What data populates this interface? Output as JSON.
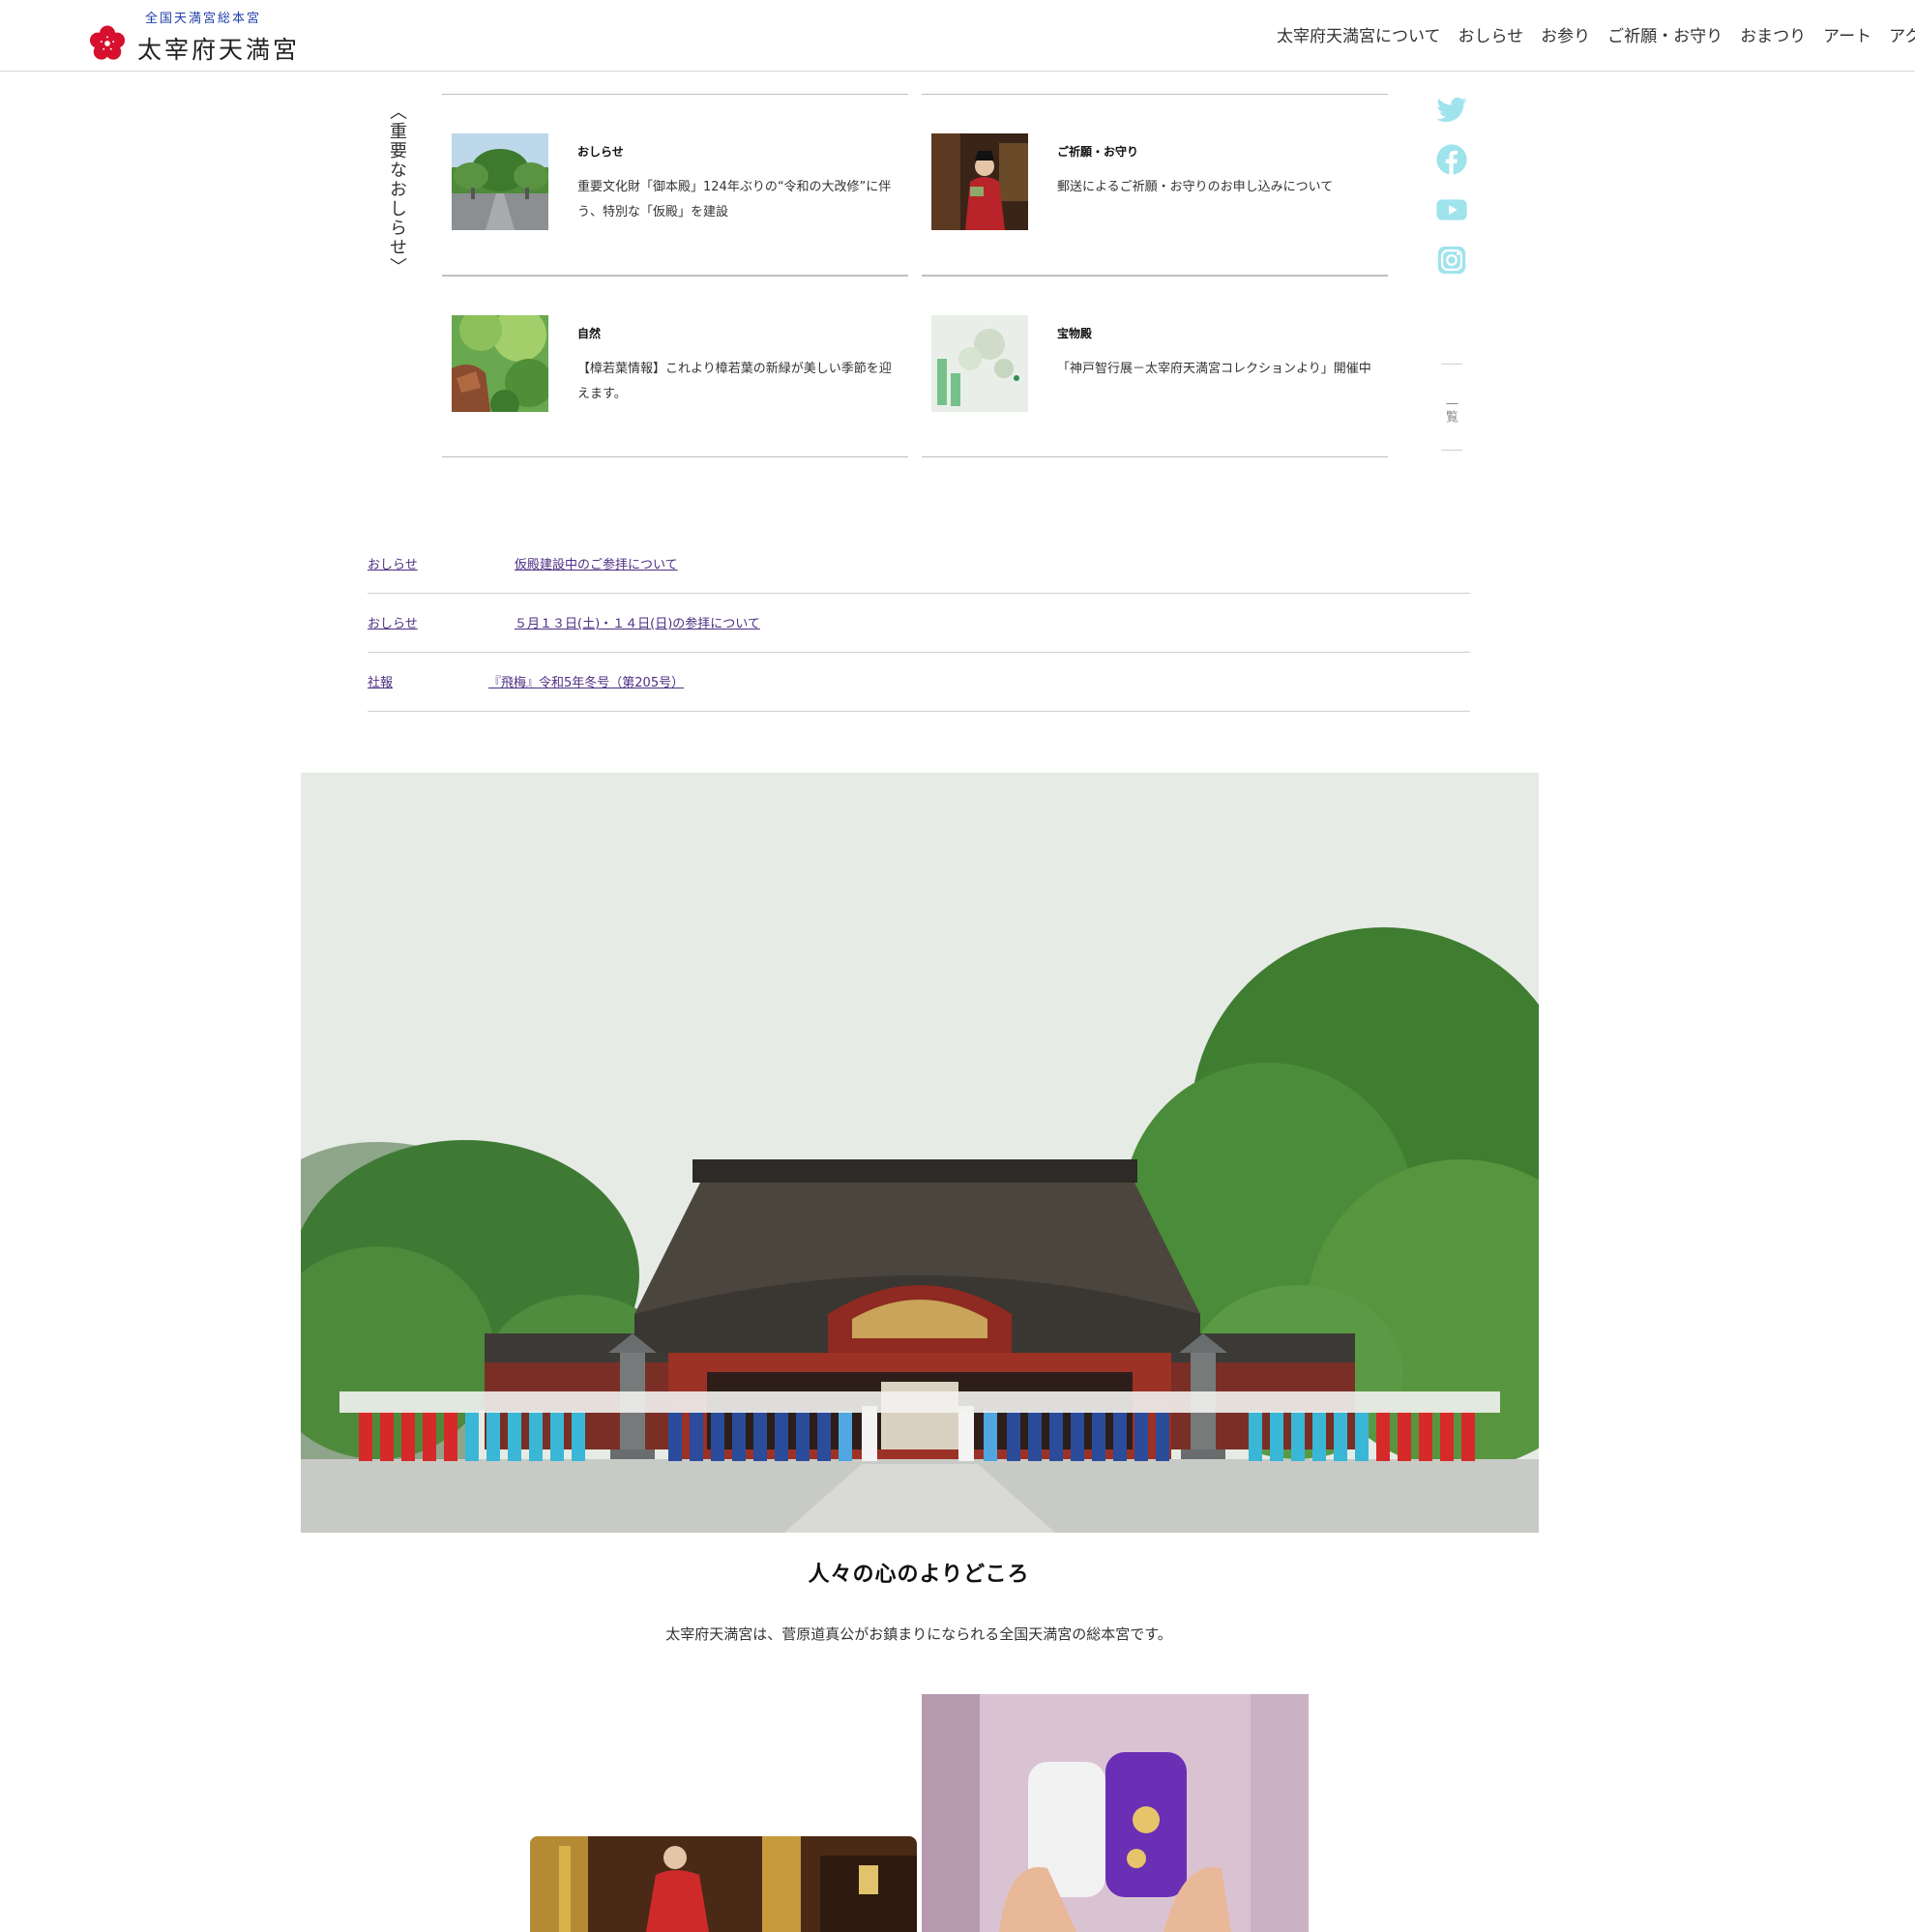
{
  "header": {
    "logo_sub": "全国天満宮総本宮",
    "logo_main": "太宰府天満宮",
    "brand_color": "#d7102e",
    "nav": [
      "太宰府天満宮について",
      "おしらせ",
      "お参り",
      "ご祈願・お守り",
      "おまつり",
      "アート",
      "アクセス"
    ]
  },
  "important": {
    "title": "〈重要なおしらせ〉",
    "cards": [
      {
        "category": "おしらせ",
        "text": "重要文化財「御本殿」124年ぶりの“令和の大改修”に伴う、特別な「仮殿」を建設"
      },
      {
        "category": "ご祈願・お守り",
        "text": "郵送によるご祈願・お守りのお申し込みについて"
      },
      {
        "category": "自然",
        "text": "【樟若葉情報】これより樟若葉の新緑が美しい季節を迎えます。"
      },
      {
        "category": "宝物殿",
        "text": "「神戸智行展－太宰府天満宮コレクションより」開催中"
      }
    ],
    "more_label": "一覧"
  },
  "social": {
    "icons": [
      "twitter-icon",
      "facebook-icon",
      "youtube-icon",
      "instagram-icon"
    ],
    "color": "#9fe3ec"
  },
  "news": [
    {
      "category": "おしらせ",
      "title": "仮殿建設中のご参拝について"
    },
    {
      "category": "おしらせ",
      "title": "５月１３日(土)・１４日(日)の参拝について"
    },
    {
      "category": "社報",
      "title": "『飛梅』令和5年冬号（第205号）"
    }
  ],
  "hero": {
    "heading": "人々の心のよりどころ",
    "description": "太宰府天満宮は、菅原道真公がお鎮まりになられる全国天満宮の総本宮です。"
  }
}
